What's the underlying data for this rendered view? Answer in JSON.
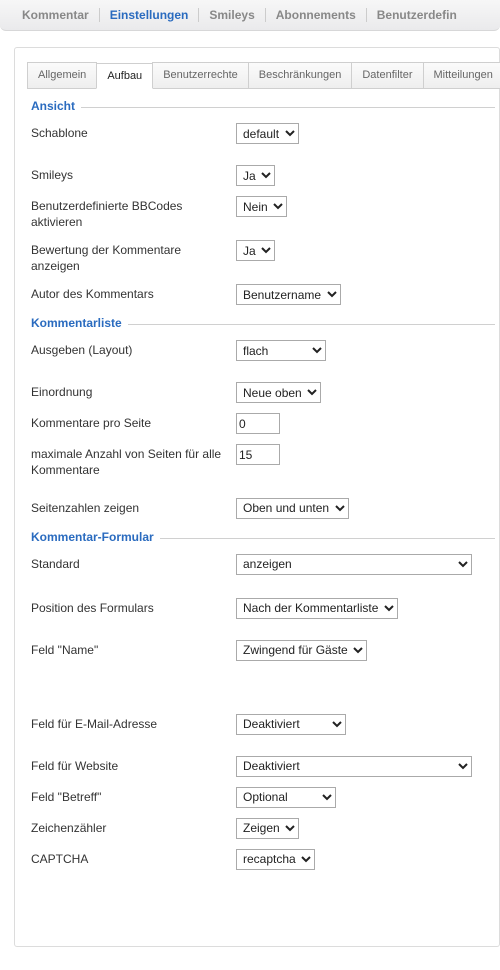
{
  "topnav": {
    "items": [
      {
        "label": "Kommentar",
        "active": false
      },
      {
        "label": "Einstellungen",
        "active": true
      },
      {
        "label": "Smileys",
        "active": false
      },
      {
        "label": "Abonnements",
        "active": false
      },
      {
        "label": "Benutzerdefin",
        "active": false
      }
    ]
  },
  "tabs": {
    "items": [
      {
        "label": "Allgemein",
        "active": false
      },
      {
        "label": "Aufbau",
        "active": true
      },
      {
        "label": "Benutzerrechte",
        "active": false
      },
      {
        "label": "Beschränkungen",
        "active": false
      },
      {
        "label": "Datenfilter",
        "active": false
      },
      {
        "label": "Mitteilungen",
        "active": false
      }
    ]
  },
  "groups": {
    "ansicht": {
      "legend": "Ansicht",
      "schablone": {
        "label": "Schablone",
        "value": "default"
      },
      "smileys": {
        "label": "Smileys",
        "value": "Ja"
      },
      "bbcodes": {
        "label": "Benutzerdefinierte BBCodes aktivieren",
        "value": "Nein"
      },
      "bewertung": {
        "label": "Bewertung der Kommentare anzeigen",
        "value": "Ja"
      },
      "autor": {
        "label": "Autor des Kommentars",
        "value": "Benutzername"
      }
    },
    "kommentarliste": {
      "legend": "Kommentarliste",
      "layout": {
        "label": "Ausgeben (Layout)",
        "value": "flach"
      },
      "einordnung": {
        "label": "Einordnung",
        "value": "Neue oben"
      },
      "proSeite": {
        "label": "Kommentare pro Seite",
        "value": "0"
      },
      "maxSeiten": {
        "label": "maximale Anzahl von Seiten für alle Kommentare",
        "value": "15"
      },
      "seitenzahlen": {
        "label": "Seitenzahlen zeigen",
        "value": "Oben und unten"
      }
    },
    "formular": {
      "legend": "Kommentar-Formular",
      "standard": {
        "label": "Standard",
        "value": "anzeigen"
      },
      "position": {
        "label": "Position des Formulars",
        "value": "Nach der Kommentarliste"
      },
      "feldName": {
        "label": "Feld \"Name\"",
        "value": "Zwingend für Gäste"
      },
      "feldEmail": {
        "label": "Feld für E-Mail-Adresse",
        "value": "Deaktiviert"
      },
      "feldWebsite": {
        "label": "Feld für Website",
        "value": "Deaktiviert"
      },
      "feldBetreff": {
        "label": "Feld \"Betreff\"",
        "value": "Optional"
      },
      "zeichenzaehler": {
        "label": "Zeichenzähler",
        "value": "Zeigen"
      },
      "captcha": {
        "label": "CAPTCHA",
        "value": "recaptcha"
      }
    }
  }
}
